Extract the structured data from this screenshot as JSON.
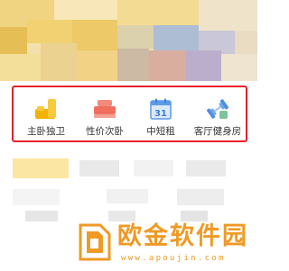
{
  "colors": {
    "highlight_border": "#e8202a",
    "label_text": "#333333",
    "watermark": "#ef9a25"
  },
  "categories": [
    {
      "label": "主卧独卫",
      "icon": "master-bedroom-icon"
    },
    {
      "label": "性价次卧",
      "icon": "bed-icon"
    },
    {
      "label": "中短租",
      "icon": "calendar-icon"
    },
    {
      "label": "客厅健身房",
      "icon": "dumbbell-icon"
    }
  ],
  "watermark": {
    "name": "欧金软件园",
    "url": "www.apoujin.com"
  }
}
